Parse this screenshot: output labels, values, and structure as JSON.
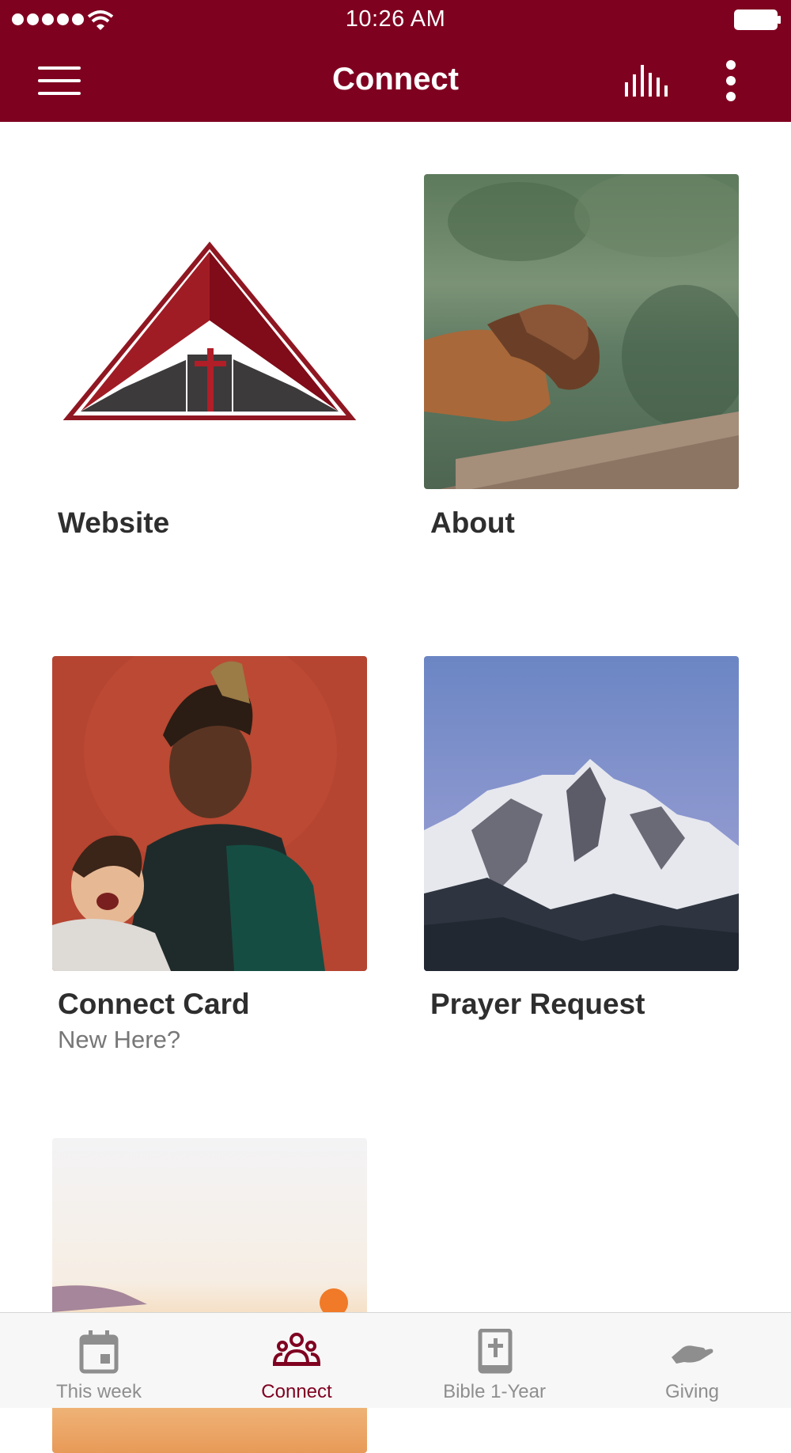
{
  "status_bar": {
    "time": "10:26 AM"
  },
  "header": {
    "title": "Connect",
    "icons": [
      "menu-icon",
      "audio-icon",
      "more-vertical-icon"
    ]
  },
  "tiles": [
    {
      "label": "Website",
      "subtitle": "",
      "image": "church-logo"
    },
    {
      "label": "About",
      "subtitle": "",
      "image": "hands-folded-over-lake"
    },
    {
      "label": "Connect Card",
      "subtitle": "New Here?",
      "image": "father-and-baby"
    },
    {
      "label": "Prayer Request",
      "subtitle": "",
      "image": "snowy-mountain"
    },
    {
      "label": "",
      "subtitle": "",
      "image": "sunrise-sky"
    }
  ],
  "tab_bar": {
    "active": "Connect",
    "tabs": [
      {
        "label": "This week",
        "icon": "calendar-icon"
      },
      {
        "label": "Connect",
        "icon": "people-group-icon"
      },
      {
        "label": "Bible 1-Year",
        "icon": "bible-icon"
      },
      {
        "label": "Giving",
        "icon": "giving-hand-icon"
      }
    ]
  },
  "colors": {
    "brand": "#7f0120",
    "tab_inactive": "#8e8e8e",
    "text": "#2e2e2e"
  }
}
